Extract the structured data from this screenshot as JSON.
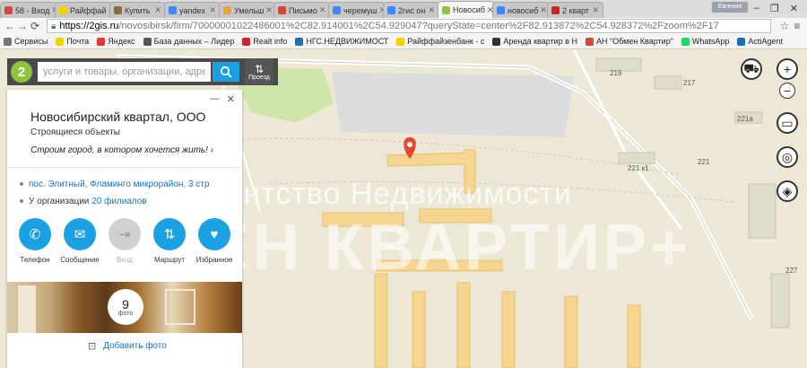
{
  "browser": {
    "tabs": [
      {
        "label": "58 - Вход",
        "color": "#d44638",
        "active": false
      },
      {
        "label": "Райффай",
        "color": "#f2d200",
        "active": false
      },
      {
        "label": "Купить",
        "color": "#8a6d3b",
        "active": false
      },
      {
        "label": "yandex",
        "color": "#4285f4",
        "active": false
      },
      {
        "label": "Умельш",
        "color": "#e8a33c",
        "active": false
      },
      {
        "label": "Письмо",
        "color": "#d44638",
        "active": false
      },
      {
        "label": "черемуш",
        "color": "#4285f4",
        "active": false
      },
      {
        "label": "2гис он",
        "color": "#4285f4",
        "active": false
      },
      {
        "label": "Новосиб",
        "color": "#8cc63f",
        "active": true
      },
      {
        "label": "новосиб",
        "color": "#4285f4",
        "active": false
      },
      {
        "label": "2 кварт",
        "color": "#c62828",
        "active": false
      }
    ],
    "user": "Евгения",
    "window_controls": [
      "–",
      "❐",
      "✕"
    ],
    "url_host": "https://2gis.ru",
    "url_path": "/novosibirsk/firm/70000001022486001%2C82.914001%2C54.929047?queryState=center%2F82.913872%2C54.928372%2Fzoom%2F17",
    "bookmarks": [
      {
        "label": "Сервисы",
        "color": "#777777"
      },
      {
        "label": "Почта",
        "color": "#f2d200"
      },
      {
        "label": "Яндекс",
        "color": "#e53935"
      },
      {
        "label": "База данных – Лидер",
        "color": "#555555"
      },
      {
        "label": "Realt info",
        "color": "#c62828"
      },
      {
        "label": "НГС.НЕДВИЖИМОСТ",
        "color": "#1a73b8"
      },
      {
        "label": "Райффайзенбанк - с",
        "color": "#f2d200"
      },
      {
        "label": "Аренда квартир в Н",
        "color": "#333333"
      },
      {
        "label": "АН \"Обмен Квартир\"",
        "color": "#d44638"
      },
      {
        "label": "WhatsApp",
        "color": "#25d366"
      },
      {
        "label": "ActiAgent",
        "color": "#1a73b8"
      }
    ]
  },
  "search": {
    "placeholder": "услуги и товары, организации, адреса",
    "logo": "2",
    "route_label": "Проезд"
  },
  "card": {
    "title": "Новосибирский квартал, ООО",
    "subtitle": "Строящиеся объекты",
    "slogan": "Строим город, в котором хочется жить!",
    "address": "пос. Элитный, Фламинго микрорайон, 3 стр",
    "branches_prefix": "У организации",
    "branches_link": "20 филиалов",
    "actions": [
      {
        "label": "Телефон",
        "icon": "phone-icon",
        "glyph": "✆",
        "enabled": true
      },
      {
        "label": "Сообщение",
        "icon": "message-icon",
        "glyph": "✉",
        "enabled": true
      },
      {
        "label": "Вход",
        "icon": "entrance-icon",
        "glyph": "⇥",
        "enabled": false
      },
      {
        "label": "Маршрут",
        "icon": "route-icon",
        "glyph": "⇅",
        "enabled": true
      },
      {
        "label": "Избранное",
        "icon": "heart-icon",
        "glyph": "♥",
        "enabled": true
      }
    ],
    "photo_count": "9",
    "photo_caption": "фото",
    "add_photo": "Добавить фото"
  },
  "map": {
    "watermark_top": "Агентство Недвижимости",
    "watermark_big": "ОБМЕН КВАРТИР+",
    "building_numbers": [
      "219",
      "217",
      "221а",
      "221 к1",
      "221",
      "227"
    ]
  }
}
